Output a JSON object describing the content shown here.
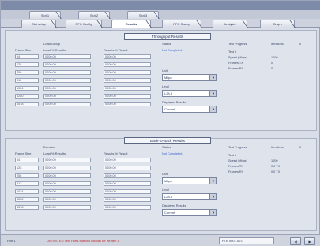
{
  "tabs_row1": [
    "Slot 1",
    "Slot 2",
    "Slot 3"
  ],
  "tabs_row2": [
    "Slot setup",
    "RFC Config",
    "Results",
    "RFC Sweep",
    "Analysis",
    "Graph"
  ],
  "active_tab_row2": 2,
  "throughput": {
    "title": "Throughput Results",
    "col_frame_size": "Frame Size",
    "col_load_group": "Load Group",
    "col_load_header": "Load % Results",
    "col_result_header": "Results % Result",
    "col_status": "Status",
    "status_link": "Not Completed",
    "rows": [
      {
        "frame": "64",
        "load": "0000.00",
        "result": "0000.00"
      },
      {
        "frame": "128",
        "load": "0000.00",
        "result": "0000.00"
      },
      {
        "frame": "256",
        "load": "0000.00",
        "result": "0000.00"
      },
      {
        "frame": "512",
        "load": "0000.00",
        "result": "0000.00"
      },
      {
        "frame": "1024",
        "load": "0000.00",
        "result": "0000.00"
      },
      {
        "frame": "1280",
        "load": "0000.00",
        "result": "0000.00"
      },
      {
        "frame": "1518",
        "load": "0000.00",
        "result": "0000.00"
      }
    ],
    "unit_label": "Unit",
    "unit_value": "Mbps",
    "level_label": "Level",
    "level_value": "L2/L3",
    "displayed_label": "Displayed Results",
    "displayed_value": "Current",
    "test_progress_label": "Test Progress",
    "test_progress_value": "Iterations",
    "test_progress_num": "0",
    "kv": [
      {
        "k": "Test #",
        "v": ""
      },
      {
        "k": "Speed (Mbps)",
        "v": "1000"
      },
      {
        "k": "Frames TX",
        "v": "0"
      },
      {
        "k": "Frames RX",
        "v": "0"
      }
    ]
  },
  "backtoback": {
    "title": "Back-to-Back Results",
    "col_frame_size": "Frame Size",
    "col_load_group": "Duration",
    "col_load_header": "Load % Results",
    "col_result_header": "Results % Result",
    "col_status": "Status",
    "status_link": "Not Completed",
    "rows": [
      {
        "frame": "64",
        "load": "0000.00",
        "result": "0000.00"
      },
      {
        "frame": "128",
        "load": "0000.00",
        "result": "0000.00"
      },
      {
        "frame": "256",
        "load": "0000.00",
        "result": "0000.00"
      },
      {
        "frame": "512",
        "load": "0000.00",
        "result": "0000.00"
      },
      {
        "frame": "1024",
        "load": "0000.00",
        "result": "0000.00"
      },
      {
        "frame": "1280",
        "load": "0000.00",
        "result": "0000.00"
      },
      {
        "frame": "1518",
        "load": "0000.00",
        "result": "0000.00"
      }
    ],
    "unit_label": "Unit",
    "unit_value": "Mbps",
    "level_label": "Level",
    "level_value": "L2/L3",
    "displayed_label": "Displayed Results",
    "displayed_value": "Current",
    "test_progress_label": "Test Progress",
    "test_progress_value": "Iterations",
    "test_progress_num": "0",
    "kv": [
      {
        "k": "Test #",
        "v": ""
      },
      {
        "k": "Speed (Mbps)",
        "v": "1000"
      },
      {
        "k": "Frames TX",
        "v": "0.0 TX"
      },
      {
        "k": "Frames RX",
        "v": "0.0 TX"
      }
    ]
  },
  "statusbar": {
    "label": "Port 1",
    "message": "UNTESTED    Test Ports Marked Display be Written 1",
    "box": "PTB 0001.00.0",
    "btn1": "◀",
    "btn2": "▶"
  },
  "colors": {
    "accent": "#7d8aa8",
    "panel": "#dfe3ec",
    "link": "#3a62c4",
    "error": "#c03030"
  }
}
